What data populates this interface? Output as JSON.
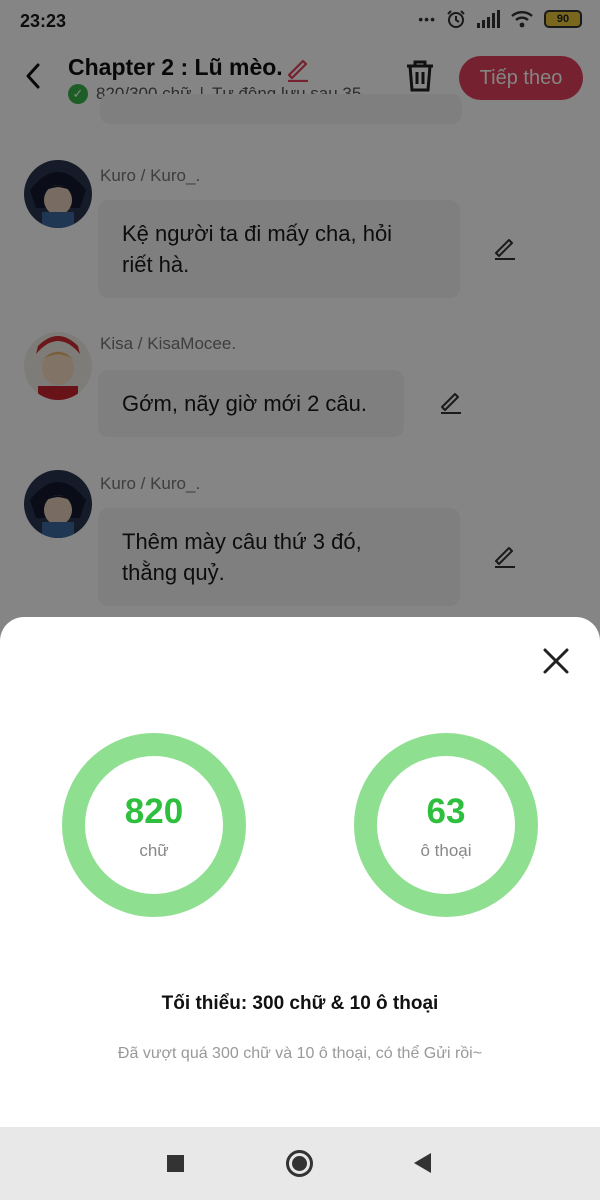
{
  "status_bar": {
    "time": "23:23",
    "battery": "90",
    "dots": "•••"
  },
  "header": {
    "title": "Chapter 2 : Lũ mèo.",
    "word_count": "820/300 chữ",
    "separator": "|",
    "autosave": "Tự động lưu sau 35",
    "next_label": "Tiếp theo"
  },
  "messages": [
    {
      "sender": "Kuro / Kuro_.",
      "lines": [
        "Kệ người ta đi mấy cha, hỏi",
        "riết hà."
      ]
    },
    {
      "sender": "Kisa / KisaMocee.",
      "lines": [
        "Gớm, nãy giờ mới 2 câu."
      ]
    },
    {
      "sender": "Kuro / Kuro_.",
      "lines": [
        "Thêm mày câu thứ 3 đó,",
        "thằng quỷ."
      ]
    }
  ],
  "sheet": {
    "stats": [
      {
        "value": "820",
        "label": "chữ"
      },
      {
        "value": "63",
        "label": "ô thoại"
      }
    ],
    "minimum": "Tối thiểu: 300 chữ & 10 ô thoại",
    "hint": "Đã vượt quá 300 chữ và 10 ô thoại, có thể Gửi rồi~"
  },
  "colors": {
    "accent": "#e0405a",
    "ring": "#8fdf91",
    "stat_number": "#2fbf3e",
    "check": "#39b54a"
  },
  "icons": [
    "back-arrow-icon",
    "pencil-icon",
    "check-icon",
    "trash-icon",
    "close-icon",
    "stop-icon",
    "home-icon",
    "nav-back-icon",
    "alarm-icon",
    "signal-icon",
    "wifi-icon",
    "battery-icon"
  ]
}
